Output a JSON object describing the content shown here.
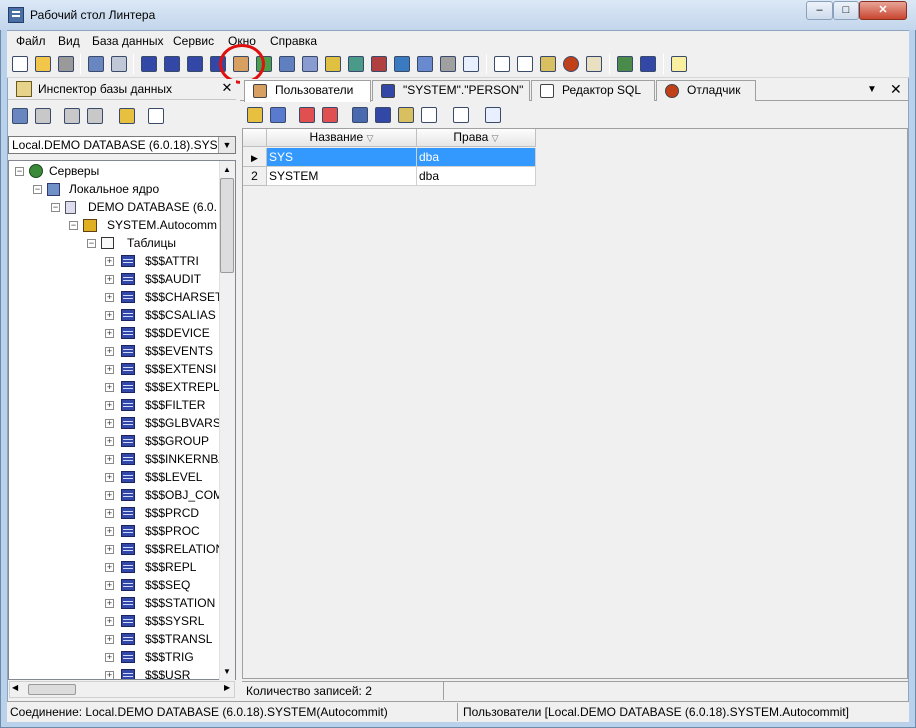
{
  "window": {
    "title": "Рабочий стол Линтера",
    "min": "–",
    "max": "□",
    "close": "✕"
  },
  "menu": [
    "Файл",
    "Вид",
    "База данных",
    "Сервис",
    "Окно",
    "Справка"
  ],
  "left_panel": {
    "title": "Инспектор базы данных",
    "close": "✕",
    "connection": "Local.DEMO DATABASE (6.0.18).SYS",
    "tree": {
      "servers": "Серверы",
      "local_core": "Локальное ядро",
      "database": "DEMO DATABASE (6.0.",
      "schema": "SYSTEM.Autocomm",
      "tables": "Таблицы",
      "items": [
        "$$$ATTRI",
        "$$$AUDIT",
        "$$$CHARSET",
        "$$$CSALIAS",
        "$$$DEVICE",
        "$$$EVENTS",
        "$$$EXTENSI",
        "$$$EXTREPL",
        "$$$FILTER",
        "$$$GLBVARS",
        "$$$GROUP",
        "$$$INKERNBA",
        "$$$LEVEL",
        "$$$OBJ_COM",
        "$$$PRCD",
        "$$$PROC",
        "$$$RELATION",
        "$$$REPL",
        "$$$SEQ",
        "$$$STATION",
        "$$$SYSRL",
        "$$$TRANSL",
        "$$$TRIG",
        "$$$USR"
      ]
    }
  },
  "tabs": [
    {
      "label": "Пользователи",
      "icon": "users-icon",
      "active": true,
      "color": "#c87830"
    },
    {
      "label": "\"SYSTEM\".\"PERSON\"",
      "icon": "table-icon",
      "active": false,
      "color": "#3347a6"
    },
    {
      "label": "Редактор SQL",
      "icon": "sql-icon",
      "active": false,
      "color": "#ffffff"
    },
    {
      "label": "Отладчик",
      "icon": "debugger-icon",
      "active": false,
      "color": "#c0401a"
    }
  ],
  "grid": {
    "columns": [
      "Название",
      "Права"
    ],
    "rows": [
      {
        "num": "",
        "name": "SYS",
        "rights": "dba",
        "selected": true
      },
      {
        "num": "2",
        "name": "SYSTEM",
        "rights": "dba",
        "selected": false
      }
    ]
  },
  "count_label": "Количество записей: 2",
  "status": {
    "left": "Соединение: Local.DEMO DATABASE (6.0.18).SYSTEM(Autocommit)",
    "right": "Пользователи [Local.DEMO DATABASE (6.0.18).SYSTEM.Autocommit]"
  },
  "colors": {
    "selection": "#3399ff",
    "highlight_circle": "#e01010"
  }
}
